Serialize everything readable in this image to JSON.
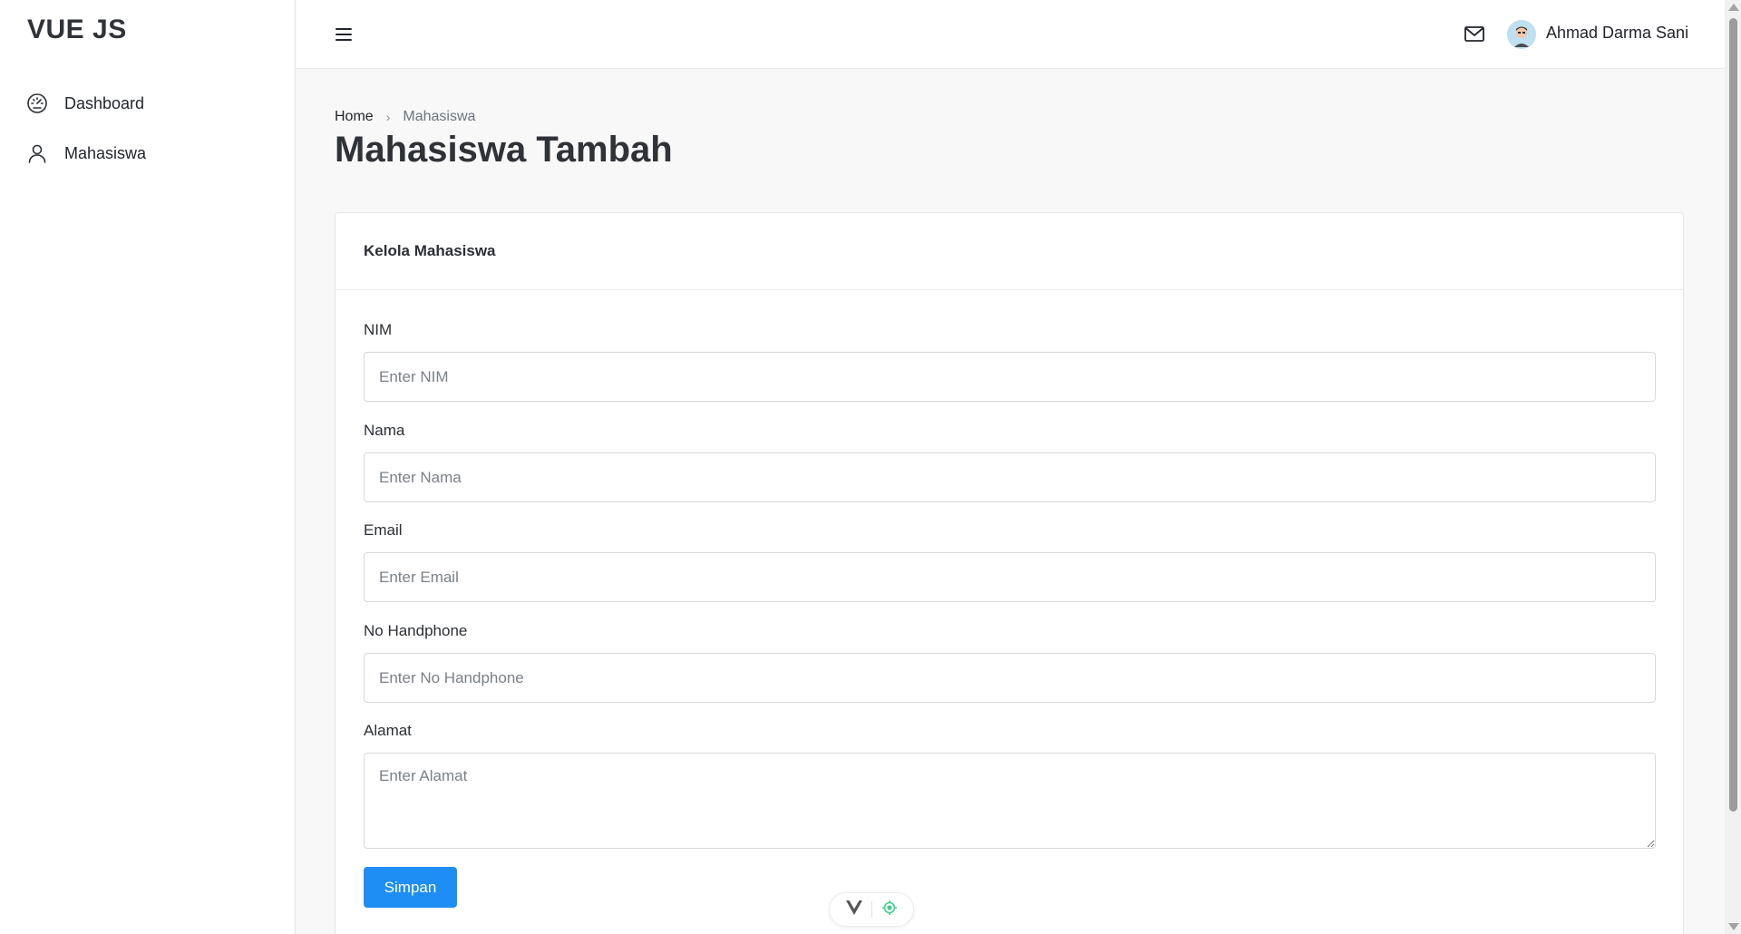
{
  "sidebar": {
    "brand": "VUE JS",
    "items": [
      {
        "label": "Dashboard",
        "icon": "speedometer-icon"
      },
      {
        "label": "Mahasiswa",
        "icon": "user-icon"
      }
    ]
  },
  "topbar": {
    "menu_icon": "hamburger-icon",
    "mail_icon": "envelope-icon",
    "user_name": "Ahmad Darma Sani"
  },
  "breadcrumb": {
    "home": "Home",
    "separator": "›",
    "current": "Mahasiswa"
  },
  "page_title": "Mahasiswa Tambah",
  "card": {
    "title": "Kelola Mahasiswa",
    "fields": [
      {
        "label": "NIM",
        "placeholder": "Enter NIM",
        "value": ""
      },
      {
        "label": "Nama",
        "placeholder": "Enter Nama",
        "value": ""
      },
      {
        "label": "Email",
        "placeholder": "Enter Email",
        "value": ""
      },
      {
        "label": "No Handphone",
        "placeholder": "Enter No Handphone",
        "value": ""
      },
      {
        "label": "Alamat",
        "placeholder": "Enter Alamat",
        "value": ""
      }
    ],
    "submit_label": "Simpan"
  },
  "colors": {
    "primary": "#1e8ef5",
    "brand_text": "#2f3237",
    "background": "#f8f8f8"
  }
}
